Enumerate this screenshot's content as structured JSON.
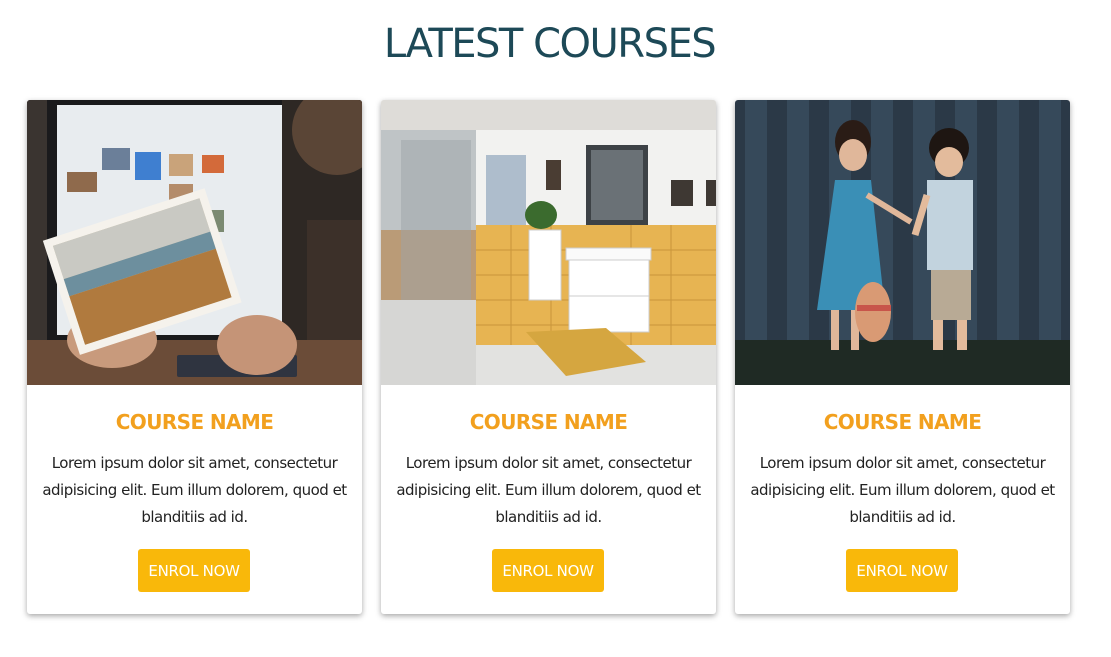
{
  "section": {
    "title": "LATEST COURSES"
  },
  "courses": [
    {
      "image_desc": "person holding a landscape photograph in front of a monitor",
      "title": "COURSE NAME",
      "text": "Lorem ipsum dolor sit amet, consectetur adipisicing elit. Eum illum dolorem, quod et blanditiis ad id.",
      "button_label": "ENROL NOW"
    },
    {
      "image_desc": "modern bathroom with yellow tiles and white vanity",
      "title": "COURSE NAME",
      "text": "Lorem ipsum dolor sit amet, consectetur adipisicing elit. Eum illum dolorem, quod et blanditiis ad id.",
      "button_label": "ENROL NOW"
    },
    {
      "image_desc": "two small children standing in front of a dark wooden fence",
      "title": "COURSE NAME",
      "text": "Lorem ipsum dolor sit amet, consectetur adipisicing elit. Eum illum dolorem, quod et blanditiis ad id.",
      "button_label": "ENROL NOW"
    }
  ],
  "colors": {
    "title": "#1d4957",
    "course_title": "#f2a01e",
    "button_bg": "#f9b80a",
    "button_text": "#ffffff"
  }
}
